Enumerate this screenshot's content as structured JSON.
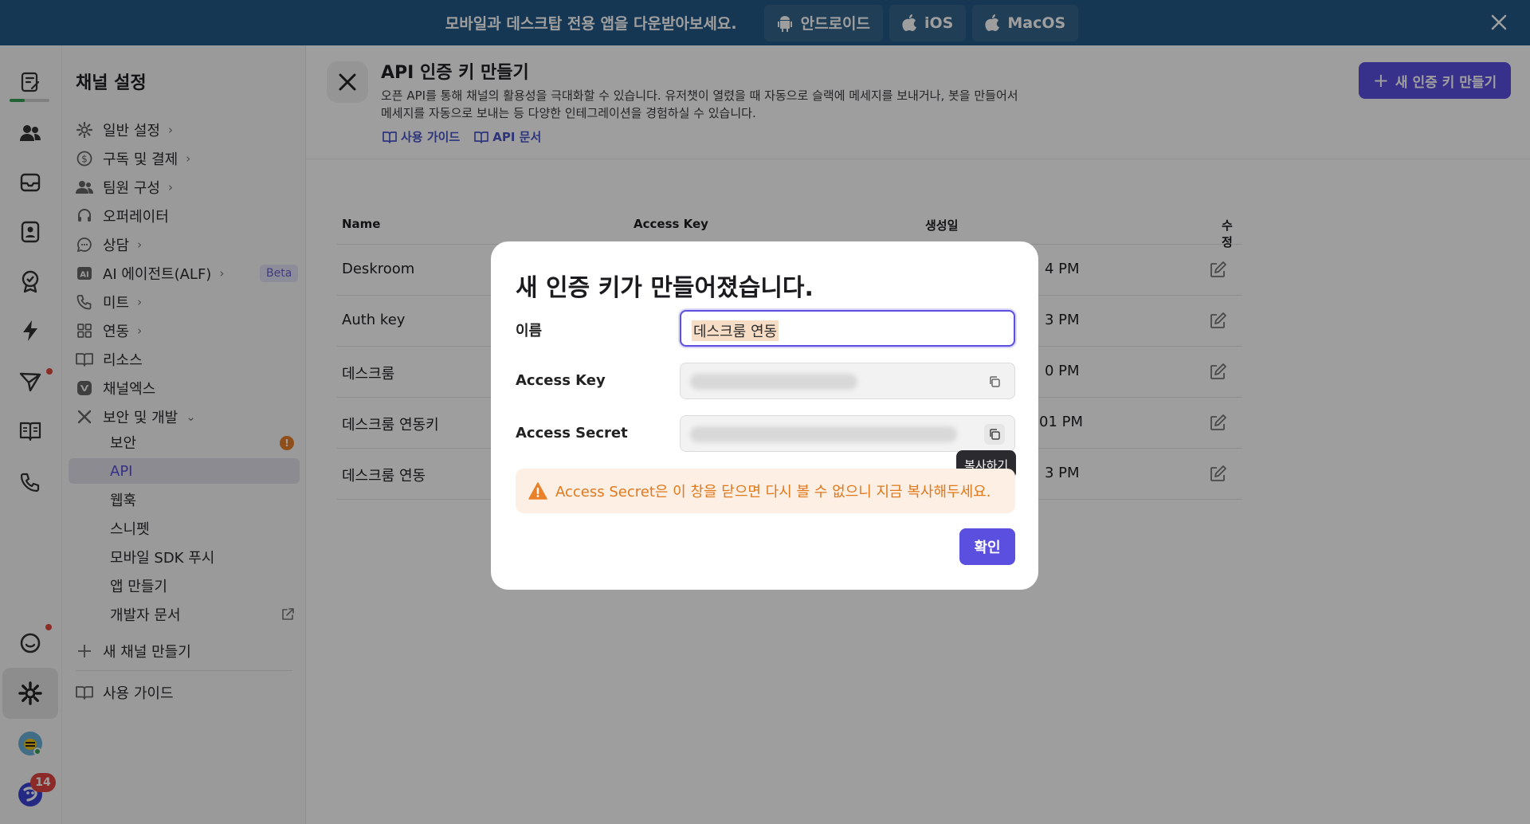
{
  "banner": {
    "message": "모바일과 데스크탑 전용 앱을 다운받아보세요.",
    "buttons": [
      {
        "label": "안드로이드",
        "icon": "android-icon"
      },
      {
        "label": "iOS",
        "icon": "apple-icon"
      },
      {
        "label": "MacOS",
        "icon": "apple-icon"
      }
    ],
    "close_icon": "close-icon"
  },
  "rail": {
    "icons": [
      "edit-note-icon",
      "users-icon",
      "inbox-icon",
      "contact-icon",
      "badge-icon",
      "bolt-icon",
      "send-icon",
      "book-icon",
      "phone-icon",
      "chat-icon",
      "gear-icon",
      "avatar-icon",
      "brand-icon"
    ],
    "badge_count": "14"
  },
  "sidebar": {
    "title": "채널 설정",
    "items": [
      {
        "label": "일반 설정",
        "icon": "gear-icon",
        "chevron": "›"
      },
      {
        "label": "구독 및 결제",
        "icon": "dollar-icon",
        "chevron": "›"
      },
      {
        "label": "팀원 구성",
        "icon": "users-icon",
        "chevron": "›"
      },
      {
        "label": "오퍼레이터",
        "icon": "headset-icon",
        "chevron": ""
      },
      {
        "label": "상담",
        "icon": "chat-icon",
        "chevron": "›"
      },
      {
        "label": "AI 에이전트(ALF)",
        "icon": "ai-icon",
        "chevron": "›"
      },
      {
        "label": "미트",
        "icon": "phone-icon",
        "chevron": "›"
      },
      {
        "label": "연동",
        "icon": "grid-icon",
        "chevron": "›"
      },
      {
        "label": "리소스",
        "icon": "book-icon",
        "chevron": ""
      },
      {
        "label": "채널엑스",
        "icon": "channelx-icon",
        "chevron": ""
      },
      {
        "label": "보안 및 개발",
        "icon": "tools-icon",
        "chevron": "⌄"
      }
    ],
    "beta_label": "Beta",
    "sub_items": [
      {
        "label": "보안"
      },
      {
        "label": "API"
      },
      {
        "label": "웹훅"
      },
      {
        "label": "스니펫"
      },
      {
        "label": "모바일 SDK 푸시"
      },
      {
        "label": "앱 만들기"
      },
      {
        "label": "개발자 문서"
      }
    ],
    "warning_badge": "!",
    "new_channel": "새 채널 만들기",
    "guide": "사용 가이드"
  },
  "header": {
    "title": "API 인증 키 만들기",
    "description_line1": "오픈 API를 통해 채널의 활용성을 극대화할 수 있습니다. 유저챗이 열렸을 때 자동으로 슬랙에 메세지를 보내거나, 봇을 만들어서",
    "description_line2": "메세지를 자동으로 보내는 등 다양한 인테그레이션을 경험하실 수 있습니다.",
    "links": [
      "사용 가이드",
      "API 문서"
    ],
    "new_key_button": "새 인증 키 만들기"
  },
  "table": {
    "columns": [
      "Name",
      "Access Key",
      "생성일",
      "수정"
    ],
    "rows": [
      {
        "name": "Deskroom",
        "created_fragment": "4 PM"
      },
      {
        "name": "Auth key",
        "created_fragment": "3 PM"
      },
      {
        "name": "데스크룸",
        "created_fragment": "0 PM"
      },
      {
        "name": "데스크룸 연동키",
        "created_fragment": "01 PM"
      },
      {
        "name": "데스크룸 연동",
        "created_fragment": "3 PM"
      }
    ]
  },
  "modal": {
    "title": "새 인증 키가 만들어졌습니다.",
    "name_label": "이름",
    "name_value": "데스크룸 연동",
    "access_key_label": "Access Key",
    "access_secret_label": "Access Secret",
    "tooltip": "복사하기",
    "warning": "Access Secret은 이 창을 닫으면 다시 볼 수 없으니 지금 복사해두세요.",
    "confirm": "확인"
  },
  "colors": {
    "banner": "#245a86",
    "accent": "#5b4fe0",
    "warning": "#e0781c",
    "warning_bg": "#fdefe3"
  }
}
